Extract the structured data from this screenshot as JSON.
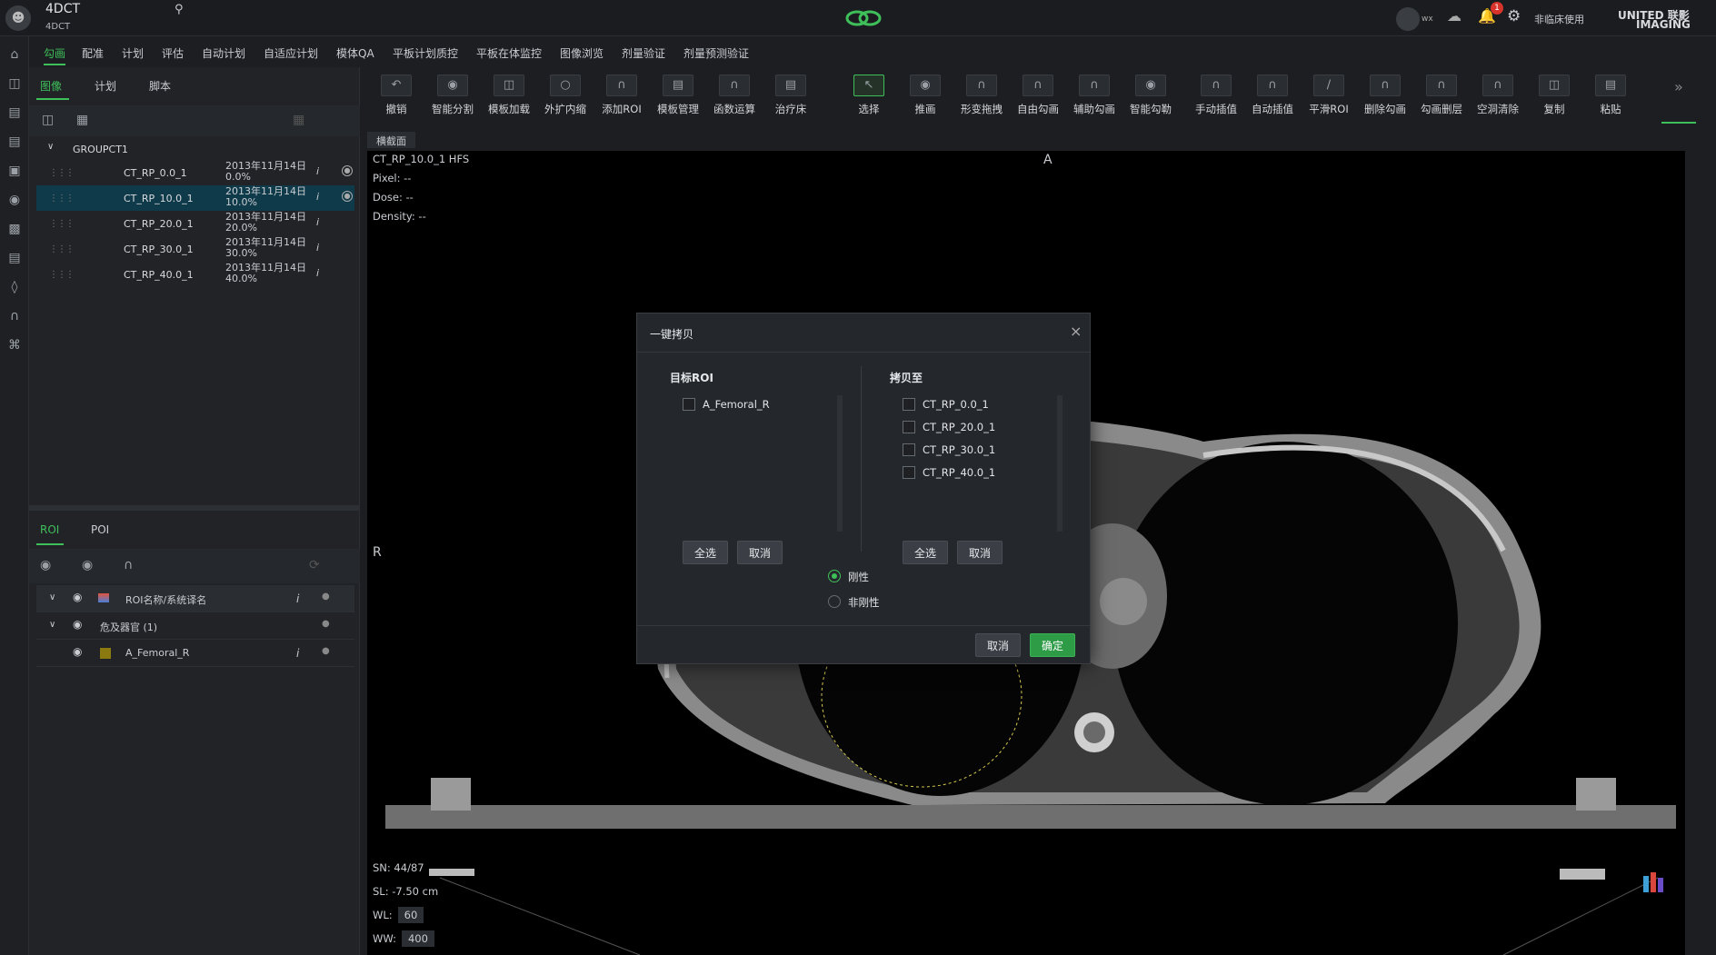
{
  "app": {
    "title": "4DCT",
    "subtitle": "4DCT",
    "user": "wx",
    "notification_count": "1",
    "mode_label": "非临床使用",
    "brand_line1": "UNITED 联影",
    "brand_line2": "IMAGING"
  },
  "menu": [
    "勾画",
    "配准",
    "计划",
    "评估",
    "自动计划",
    "自适应计划",
    "模体QA",
    "平板计划质控",
    "平板在体监控",
    "图像浏览",
    "剂量验证",
    "剂量预测验证"
  ],
  "left_panel": {
    "tabs": [
      "图像",
      "计划",
      "脚本"
    ],
    "group_name": "GROUPCT1",
    "series": [
      {
        "name": "CT_RP_0.0_1",
        "date": "2013年11月14日",
        "pct": "0.0%"
      },
      {
        "name": "CT_RP_10.0_1",
        "date": "2013年11月14日",
        "pct": "10.0%"
      },
      {
        "name": "CT_RP_20.0_1",
        "date": "2013年11月14日",
        "pct": "20.0%"
      },
      {
        "name": "CT_RP_30.0_1",
        "date": "2013年11月14日",
        "pct": "30.0%"
      },
      {
        "name": "CT_RP_40.0_1",
        "date": "2013年11月14日",
        "pct": "40.0%"
      }
    ],
    "info_glyph": "i",
    "roi_tabs": [
      "ROI",
      "POI"
    ],
    "roi_header": "ROI名称/系统译名",
    "roi_group": "危及器官 (1)",
    "roi_item": "A_Femoral_R",
    "roi_item_color": "#8a7a10"
  },
  "toolbar": [
    "撤销",
    "智能分割",
    "模板加载",
    "外扩内缩",
    "添加ROI",
    "模板管理",
    "函数运算",
    "治疗床",
    "选择",
    "推画",
    "形变拖拽",
    "自由勾画",
    "辅助勾画",
    "智能勾勒",
    "手动插值",
    "自动插值",
    "平滑ROI",
    "删除勾画",
    "勾画删层",
    "空洞清除",
    "复制",
    "粘贴"
  ],
  "viewer": {
    "tab": "横截面",
    "series_label": "CT_RP_10.0_1 HFS",
    "pixel": "Pixel: --",
    "dose": "Dose: --",
    "density": "Density: --",
    "orient_top": "A",
    "orient_left": "R",
    "sn": "SN: 44/87",
    "sl": "SL: -7.50 cm",
    "wl_label": "WL:",
    "wl_value": "60",
    "ww_label": "WW:",
    "ww_value": "400"
  },
  "dialog": {
    "title": "一键拷贝",
    "left_title": "目标ROI",
    "left_items": [
      "A_Femoral_R"
    ],
    "right_title": "拷贝至",
    "right_items": [
      "CT_RP_0.0_1",
      "CT_RP_20.0_1",
      "CT_RP_30.0_1",
      "CT_RP_40.0_1"
    ],
    "select_all": "全选",
    "cancel_small": "取消",
    "radio_rigid": "刚性",
    "radio_nonrigid": "非刚性",
    "cancel": "取消",
    "ok": "确定",
    "close": "×"
  },
  "colors": {
    "accent": "#3fbf5a",
    "selected_row": "#0f3a4a"
  }
}
